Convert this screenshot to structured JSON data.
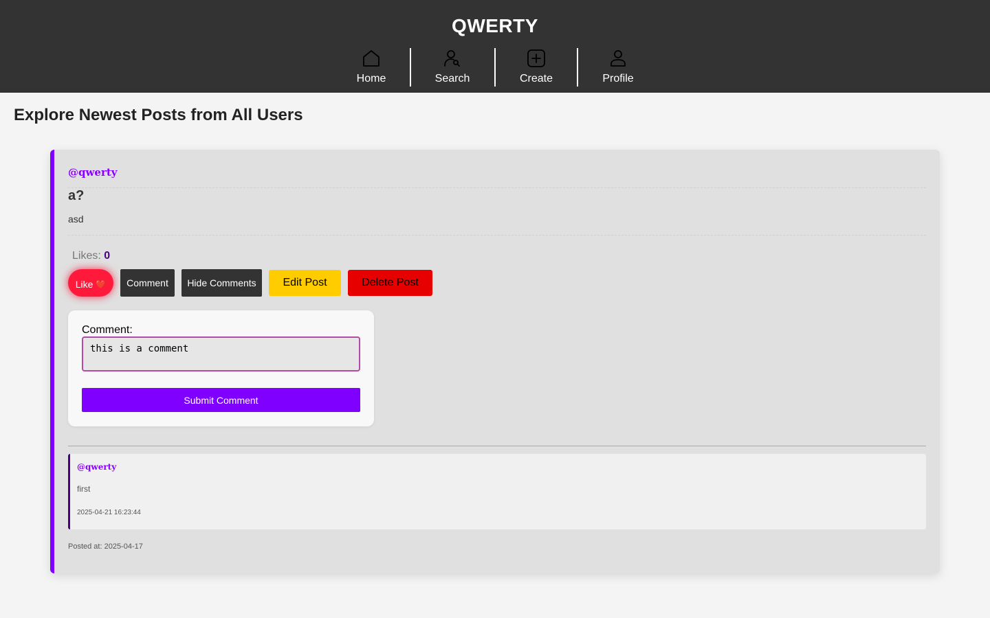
{
  "header": {
    "brand": "QWERTY",
    "nav": [
      {
        "label": "Home",
        "icon": "home-icon"
      },
      {
        "label": "Search",
        "icon": "search-user-icon"
      },
      {
        "label": "Create",
        "icon": "plus-square-icon"
      },
      {
        "label": "Profile",
        "icon": "user-icon"
      }
    ]
  },
  "main": {
    "title": "Explore Newest Posts from All Users"
  },
  "post": {
    "username": "@qwerty",
    "title": "a?",
    "body": "asd",
    "likes_label": "Likes:",
    "likes_count": "0",
    "buttons": {
      "like": "Like",
      "like_emoji": "❤️",
      "comment": "Comment",
      "hide_comments": "Hide Comments",
      "edit": "Edit Post",
      "delete": "Delete Post"
    },
    "comment_form": {
      "label": "Comment:",
      "value": "this is a comment",
      "submit": "Submit Comment"
    },
    "comments": [
      {
        "username": "@qwerty",
        "text": "first",
        "timestamp": "2025-04-21 16:23:44"
      }
    ],
    "posted_at": "Posted at: 2025-04-17"
  },
  "colors": {
    "header_bg": "#333333",
    "accent": "#8000ff",
    "like": "#ff1a3c",
    "edit": "#ffcc00",
    "delete": "#e60000"
  }
}
